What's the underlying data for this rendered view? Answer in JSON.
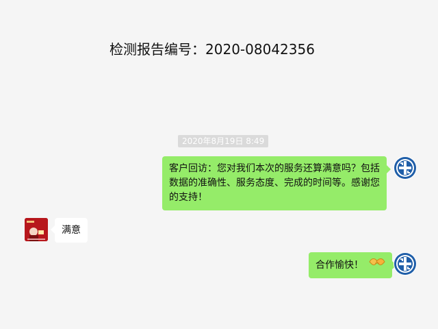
{
  "header": {
    "title": "检测报告编号：2020-08042356"
  },
  "chat": {
    "timestamp": "2020年8月19日 8:49",
    "messages": [
      {
        "side": "right",
        "text": "客户回访：您对我们本次的服务还算满意吗？包括数据的准确性、服务态度、完成的时间等。感谢您的支持！"
      },
      {
        "side": "left",
        "text": "满意"
      },
      {
        "side": "right",
        "text": "合作愉快！",
        "emoji": "handshake-icon"
      }
    ]
  },
  "colors": {
    "background": "#f5f5f5",
    "outgoing_bubble": "#95ec69",
    "incoming_bubble": "#ffffff",
    "timestamp_bg": "#dadada",
    "logo_blue": "#1f5ea8"
  }
}
